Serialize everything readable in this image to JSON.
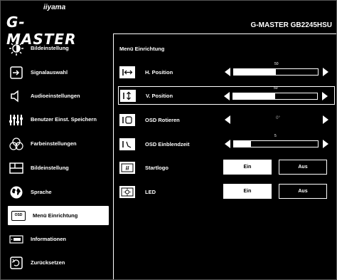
{
  "brand": {
    "top": "iiyama",
    "name": "G-MASTER"
  },
  "model": "G-MASTER GB2245HSU",
  "sidebar": {
    "items": [
      {
        "label": "Bildeinstellung",
        "icon": "brightness-icon"
      },
      {
        "label": "Signalauswahl",
        "icon": "input-icon"
      },
      {
        "label": "Audioeinstellungen",
        "icon": "speaker-icon"
      },
      {
        "label": "Benutzer Einst. Speichern",
        "icon": "equalizer-icon"
      },
      {
        "label": "Farbeinstellungen",
        "icon": "rgb-icon"
      },
      {
        "label": "Bildeinstellung",
        "icon": "layout-icon"
      },
      {
        "label": "Sprache",
        "icon": "globe-icon"
      },
      {
        "label": "Menü Einrichtung",
        "icon": "osd-icon",
        "icon_text": "OSD"
      },
      {
        "label": "Informationen",
        "icon": "info-icon"
      },
      {
        "label": "Zurücksetzen",
        "icon": "reset-icon"
      }
    ]
  },
  "panel": {
    "title": "Menü Einrichtung",
    "rows": [
      {
        "label": "H. Position",
        "type": "slider",
        "value": "50",
        "level": 0.5
      },
      {
        "label": "V. Position",
        "type": "slider",
        "value": "50",
        "level": 0.5
      },
      {
        "label": "OSD Rotieren",
        "type": "option",
        "value": "0°"
      },
      {
        "label": "OSD Einblendzeit",
        "type": "slider",
        "value": "5",
        "level": 0.2
      },
      {
        "label": "Startlogo",
        "type": "toggle",
        "on": "Ein",
        "off": "Aus"
      },
      {
        "label": "LED",
        "type": "toggle",
        "on": "Ein",
        "off": "Aus"
      }
    ]
  }
}
